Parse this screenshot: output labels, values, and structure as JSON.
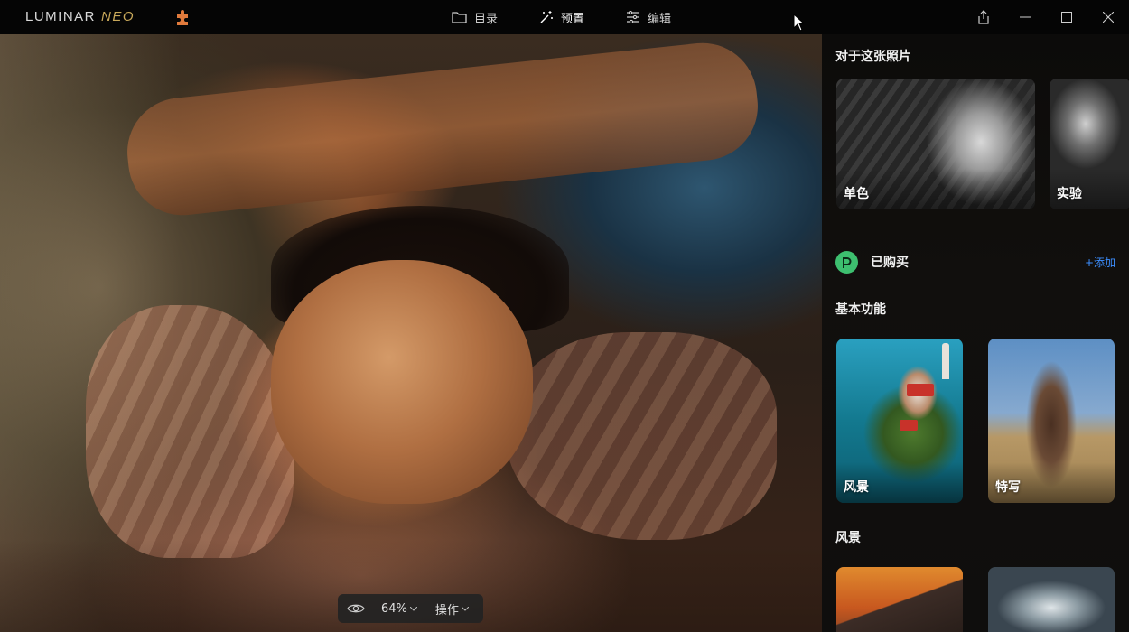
{
  "app": {
    "logo_text": "LUMINAR",
    "logo_suffix": "NEO"
  },
  "nav": {
    "items": [
      {
        "label": "目录",
        "icon": "folder-icon",
        "active": false
      },
      {
        "label": "预置",
        "icon": "magic-wand-icon",
        "active": true
      },
      {
        "label": "编辑",
        "icon": "sliders-icon",
        "active": false
      }
    ]
  },
  "canvas": {
    "zoom": "64%",
    "actions_label": "操作"
  },
  "panel": {
    "about_title": "对于这张照片",
    "about_cards": [
      {
        "label": "单色"
      },
      {
        "label": "实验"
      }
    ],
    "purchased_label": "已购买",
    "add_label": "+添加",
    "basic_title": "基本功能",
    "basic_cards": [
      {
        "label": "风景"
      },
      {
        "label": "特写"
      }
    ],
    "landscape_title": "风景"
  },
  "colors": {
    "accent_link": "#3c8eff",
    "purchased_badge": "#3dbf6f",
    "panel_bg": "#0f0e0d"
  }
}
